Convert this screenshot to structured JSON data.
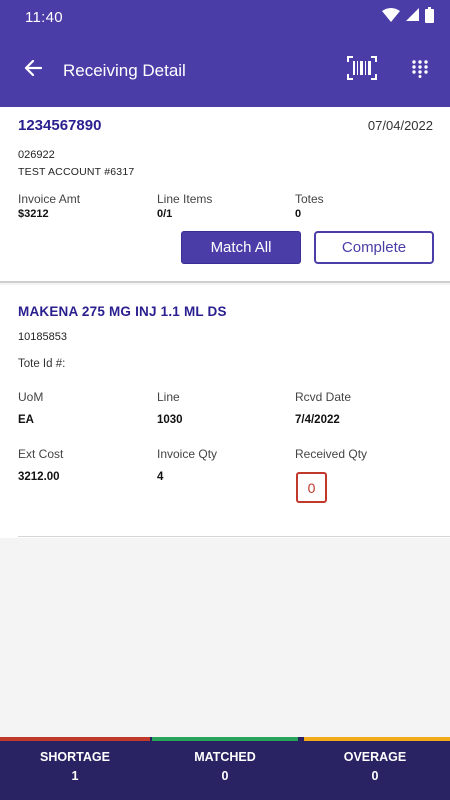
{
  "status_bar": {
    "time": "11:40"
  },
  "app_bar": {
    "title": "Receiving Detail"
  },
  "invoice": {
    "number": "1234567890",
    "date": "07/04/2022",
    "account_id": "026922",
    "account_name": "TEST ACCOUNT #6317",
    "stats": [
      {
        "label": "Invoice Amt",
        "value": "$3212"
      },
      {
        "label": "Line Items",
        "value": "0/1"
      },
      {
        "label": "Totes",
        "value": "0"
      }
    ],
    "match_all_label": "Match All",
    "complete_label": "Complete"
  },
  "item": {
    "name": "MAKENA 275 MG INJ 1.1 ML DS",
    "ndc": "10185853",
    "tote_label": "Tote Id #:",
    "fields": [
      {
        "label": "UoM",
        "value": "EA"
      },
      {
        "label": "Line",
        "value": "1030"
      },
      {
        "label": "Rcvd Date",
        "value": "7/4/2022"
      },
      {
        "label": "Ext Cost",
        "value": "3212.00"
      },
      {
        "label": "Invoice Qty",
        "value": "4"
      },
      {
        "label": "Received Qty",
        "value": "0"
      }
    ]
  },
  "summary": [
    {
      "label": "SHORTAGE",
      "value": "1",
      "color": "#c0392b"
    },
    {
      "label": "MATCHED",
      "value": "0",
      "color": "#27a35a"
    },
    {
      "label": "OVERAGE",
      "value": "0",
      "color": "#f2a91a"
    }
  ],
  "colors": {
    "primary": "#4a3da8",
    "accent_text": "#2a1f8f",
    "footer": "#2a2363"
  }
}
